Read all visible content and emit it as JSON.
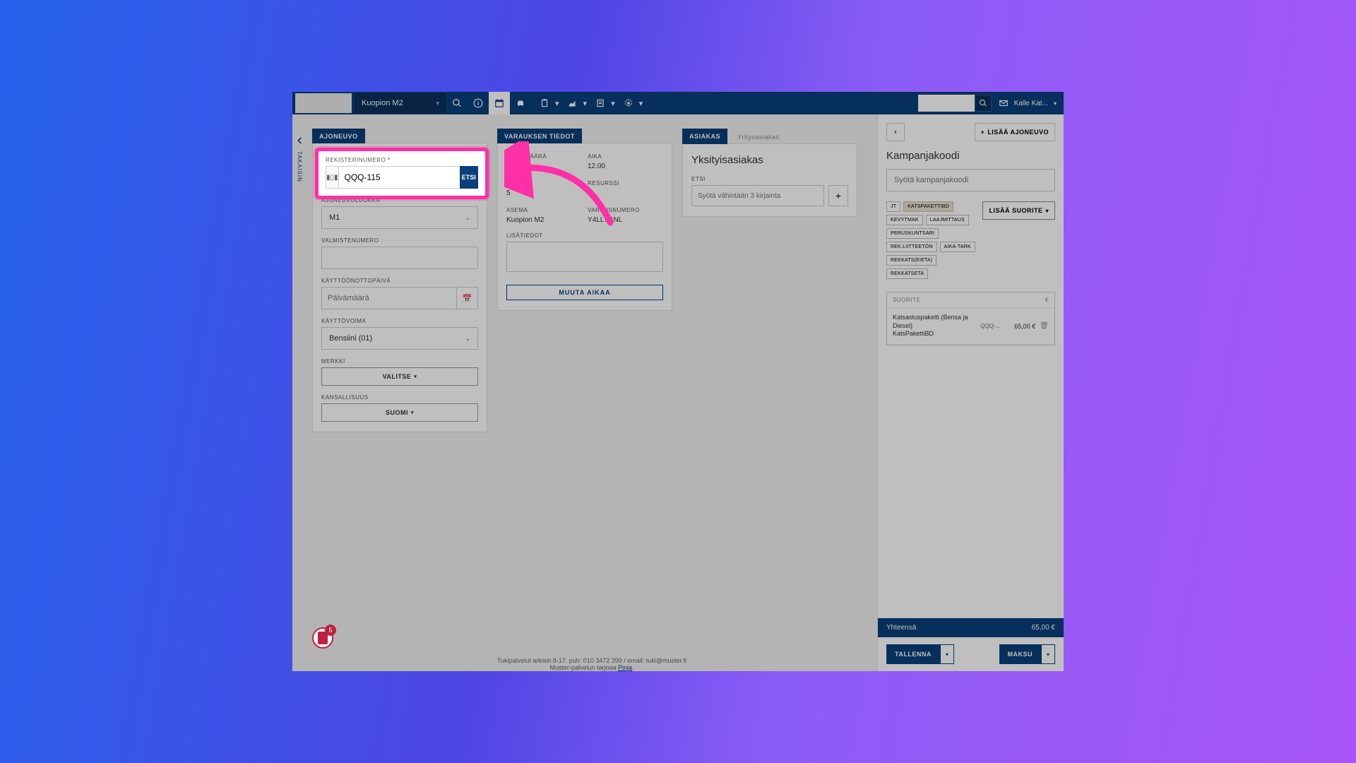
{
  "topbar": {
    "station": "Kuopion M2",
    "user": "Kalle Kat..."
  },
  "back_label": "TAKAISIN",
  "tabs": {
    "vehicle": "AJONEUVO",
    "booking": "VARAUKSEN TIEDOT",
    "customer_active": "ASIAKAS",
    "customer_inactive": "Yritysasiakas"
  },
  "vehicle": {
    "reg_label": "REKISTERINUMERO",
    "reg_value": "QQQ-115",
    "etsi": "ETSI",
    "class_label": "AJONEUVOLUOKKA",
    "class_value": "M1",
    "vin_label": "VALMISTENUMERO",
    "vin_value": "",
    "firstuse_label": "KÄYTTÖÖNOTTOPÄIVÄ",
    "firstuse_placeholder": "Päivämäärä",
    "power_label": "KÄYTTÖVOIMA",
    "power_value": "Bensiini (01)",
    "brand_label": "MERKKI",
    "brand_btn": "VALITSE",
    "nationality_label": "KANSALLISUUS",
    "nationality_btn": "SUOMI"
  },
  "booking": {
    "date_label": "PÄIVÄMÄÄRÄ",
    "date_value": "25.",
    "time_label": "AIKA",
    "time_value": "12.00",
    "duration_label": "KESTO",
    "duration_value": "5",
    "resource_label": "RESURSSI",
    "resource_value": "",
    "station_label": "ASEMA",
    "station_value": "Kuopion M2",
    "bookingno_label": "VARAUSNUMERO",
    "bookingno_value": "Y4LLTGNL",
    "extra_label": "LISÄTIEDOT",
    "change_time": "MUUTA AIKAA"
  },
  "customer": {
    "title": "Yksityisasiakas",
    "search_label": "ETSI",
    "search_placeholder": "Syötä vähintään 3 kirjainta"
  },
  "right": {
    "add_vehicle": "LISÄÄ AJONEUVO",
    "campaign_title": "Kampanjakoodi",
    "campaign_placeholder": "Syötä kampanjakoodi",
    "lisaa_suorite": "LISÄÄ SUORITE",
    "pills": [
      "JT",
      "KATSPAKETTIBD",
      "KEVYTMAK",
      "LAAJMITTAUS",
      "PERUSKUNTSARI",
      "REK.LIITTEETÖN",
      "AIKA-TARK",
      "REKKATS(EIETA)",
      "REKKATSETA"
    ],
    "pill_selected_index": 1,
    "suorite_header": "SUORITE",
    "euro_header": "€",
    "line": {
      "name1": "Katsastuspaketti (Bensa ja Diesel)",
      "name2": "KatsPakettiBD",
      "code": "QQQ-...",
      "price": "65,00 €"
    },
    "total_label": "Yhteensä",
    "total_value": "65,00 €",
    "save": "TALLENNA",
    "pay": "MAKSU"
  },
  "footer": {
    "line1": "Tukipalvelut arkisin 8-17. puh: 010 3472 399 / email: tuki@muster.fi",
    "line2_pre": "Muster-palvelun tarjoaa ",
    "line2_link": "Pinja"
  },
  "notif_count": "5"
}
